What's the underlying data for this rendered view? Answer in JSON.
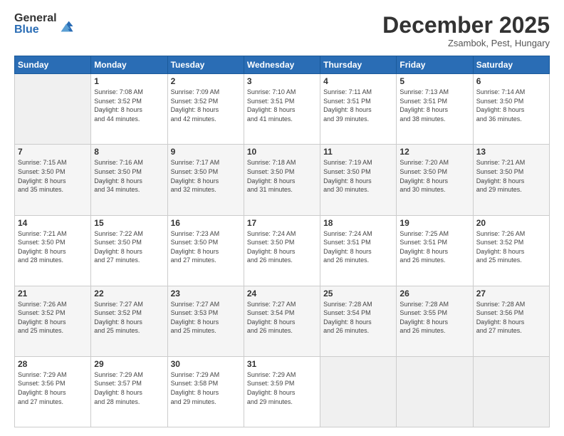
{
  "logo": {
    "general": "General",
    "blue": "Blue"
  },
  "header": {
    "month": "December 2025",
    "location": "Zsambok, Pest, Hungary"
  },
  "weekdays": [
    "Sunday",
    "Monday",
    "Tuesday",
    "Wednesday",
    "Thursday",
    "Friday",
    "Saturday"
  ],
  "weeks": [
    [
      {
        "day": "",
        "info": ""
      },
      {
        "day": "1",
        "info": "Sunrise: 7:08 AM\nSunset: 3:52 PM\nDaylight: 8 hours\nand 44 minutes."
      },
      {
        "day": "2",
        "info": "Sunrise: 7:09 AM\nSunset: 3:52 PM\nDaylight: 8 hours\nand 42 minutes."
      },
      {
        "day": "3",
        "info": "Sunrise: 7:10 AM\nSunset: 3:51 PM\nDaylight: 8 hours\nand 41 minutes."
      },
      {
        "day": "4",
        "info": "Sunrise: 7:11 AM\nSunset: 3:51 PM\nDaylight: 8 hours\nand 39 minutes."
      },
      {
        "day": "5",
        "info": "Sunrise: 7:13 AM\nSunset: 3:51 PM\nDaylight: 8 hours\nand 38 minutes."
      },
      {
        "day": "6",
        "info": "Sunrise: 7:14 AM\nSunset: 3:50 PM\nDaylight: 8 hours\nand 36 minutes."
      }
    ],
    [
      {
        "day": "7",
        "info": "Sunrise: 7:15 AM\nSunset: 3:50 PM\nDaylight: 8 hours\nand 35 minutes."
      },
      {
        "day": "8",
        "info": "Sunrise: 7:16 AM\nSunset: 3:50 PM\nDaylight: 8 hours\nand 34 minutes."
      },
      {
        "day": "9",
        "info": "Sunrise: 7:17 AM\nSunset: 3:50 PM\nDaylight: 8 hours\nand 32 minutes."
      },
      {
        "day": "10",
        "info": "Sunrise: 7:18 AM\nSunset: 3:50 PM\nDaylight: 8 hours\nand 31 minutes."
      },
      {
        "day": "11",
        "info": "Sunrise: 7:19 AM\nSunset: 3:50 PM\nDaylight: 8 hours\nand 30 minutes."
      },
      {
        "day": "12",
        "info": "Sunrise: 7:20 AM\nSunset: 3:50 PM\nDaylight: 8 hours\nand 30 minutes."
      },
      {
        "day": "13",
        "info": "Sunrise: 7:21 AM\nSunset: 3:50 PM\nDaylight: 8 hours\nand 29 minutes."
      }
    ],
    [
      {
        "day": "14",
        "info": "Sunrise: 7:21 AM\nSunset: 3:50 PM\nDaylight: 8 hours\nand 28 minutes."
      },
      {
        "day": "15",
        "info": "Sunrise: 7:22 AM\nSunset: 3:50 PM\nDaylight: 8 hours\nand 27 minutes."
      },
      {
        "day": "16",
        "info": "Sunrise: 7:23 AM\nSunset: 3:50 PM\nDaylight: 8 hours\nand 27 minutes."
      },
      {
        "day": "17",
        "info": "Sunrise: 7:24 AM\nSunset: 3:50 PM\nDaylight: 8 hours\nand 26 minutes."
      },
      {
        "day": "18",
        "info": "Sunrise: 7:24 AM\nSunset: 3:51 PM\nDaylight: 8 hours\nand 26 minutes."
      },
      {
        "day": "19",
        "info": "Sunrise: 7:25 AM\nSunset: 3:51 PM\nDaylight: 8 hours\nand 26 minutes."
      },
      {
        "day": "20",
        "info": "Sunrise: 7:26 AM\nSunset: 3:52 PM\nDaylight: 8 hours\nand 25 minutes."
      }
    ],
    [
      {
        "day": "21",
        "info": "Sunrise: 7:26 AM\nSunset: 3:52 PM\nDaylight: 8 hours\nand 25 minutes."
      },
      {
        "day": "22",
        "info": "Sunrise: 7:27 AM\nSunset: 3:52 PM\nDaylight: 8 hours\nand 25 minutes."
      },
      {
        "day": "23",
        "info": "Sunrise: 7:27 AM\nSunset: 3:53 PM\nDaylight: 8 hours\nand 25 minutes."
      },
      {
        "day": "24",
        "info": "Sunrise: 7:27 AM\nSunset: 3:54 PM\nDaylight: 8 hours\nand 26 minutes."
      },
      {
        "day": "25",
        "info": "Sunrise: 7:28 AM\nSunset: 3:54 PM\nDaylight: 8 hours\nand 26 minutes."
      },
      {
        "day": "26",
        "info": "Sunrise: 7:28 AM\nSunset: 3:55 PM\nDaylight: 8 hours\nand 26 minutes."
      },
      {
        "day": "27",
        "info": "Sunrise: 7:28 AM\nSunset: 3:56 PM\nDaylight: 8 hours\nand 27 minutes."
      }
    ],
    [
      {
        "day": "28",
        "info": "Sunrise: 7:29 AM\nSunset: 3:56 PM\nDaylight: 8 hours\nand 27 minutes."
      },
      {
        "day": "29",
        "info": "Sunrise: 7:29 AM\nSunset: 3:57 PM\nDaylight: 8 hours\nand 28 minutes."
      },
      {
        "day": "30",
        "info": "Sunrise: 7:29 AM\nSunset: 3:58 PM\nDaylight: 8 hours\nand 29 minutes."
      },
      {
        "day": "31",
        "info": "Sunrise: 7:29 AM\nSunset: 3:59 PM\nDaylight: 8 hours\nand 29 minutes."
      },
      {
        "day": "",
        "info": ""
      },
      {
        "day": "",
        "info": ""
      },
      {
        "day": "",
        "info": ""
      }
    ]
  ]
}
